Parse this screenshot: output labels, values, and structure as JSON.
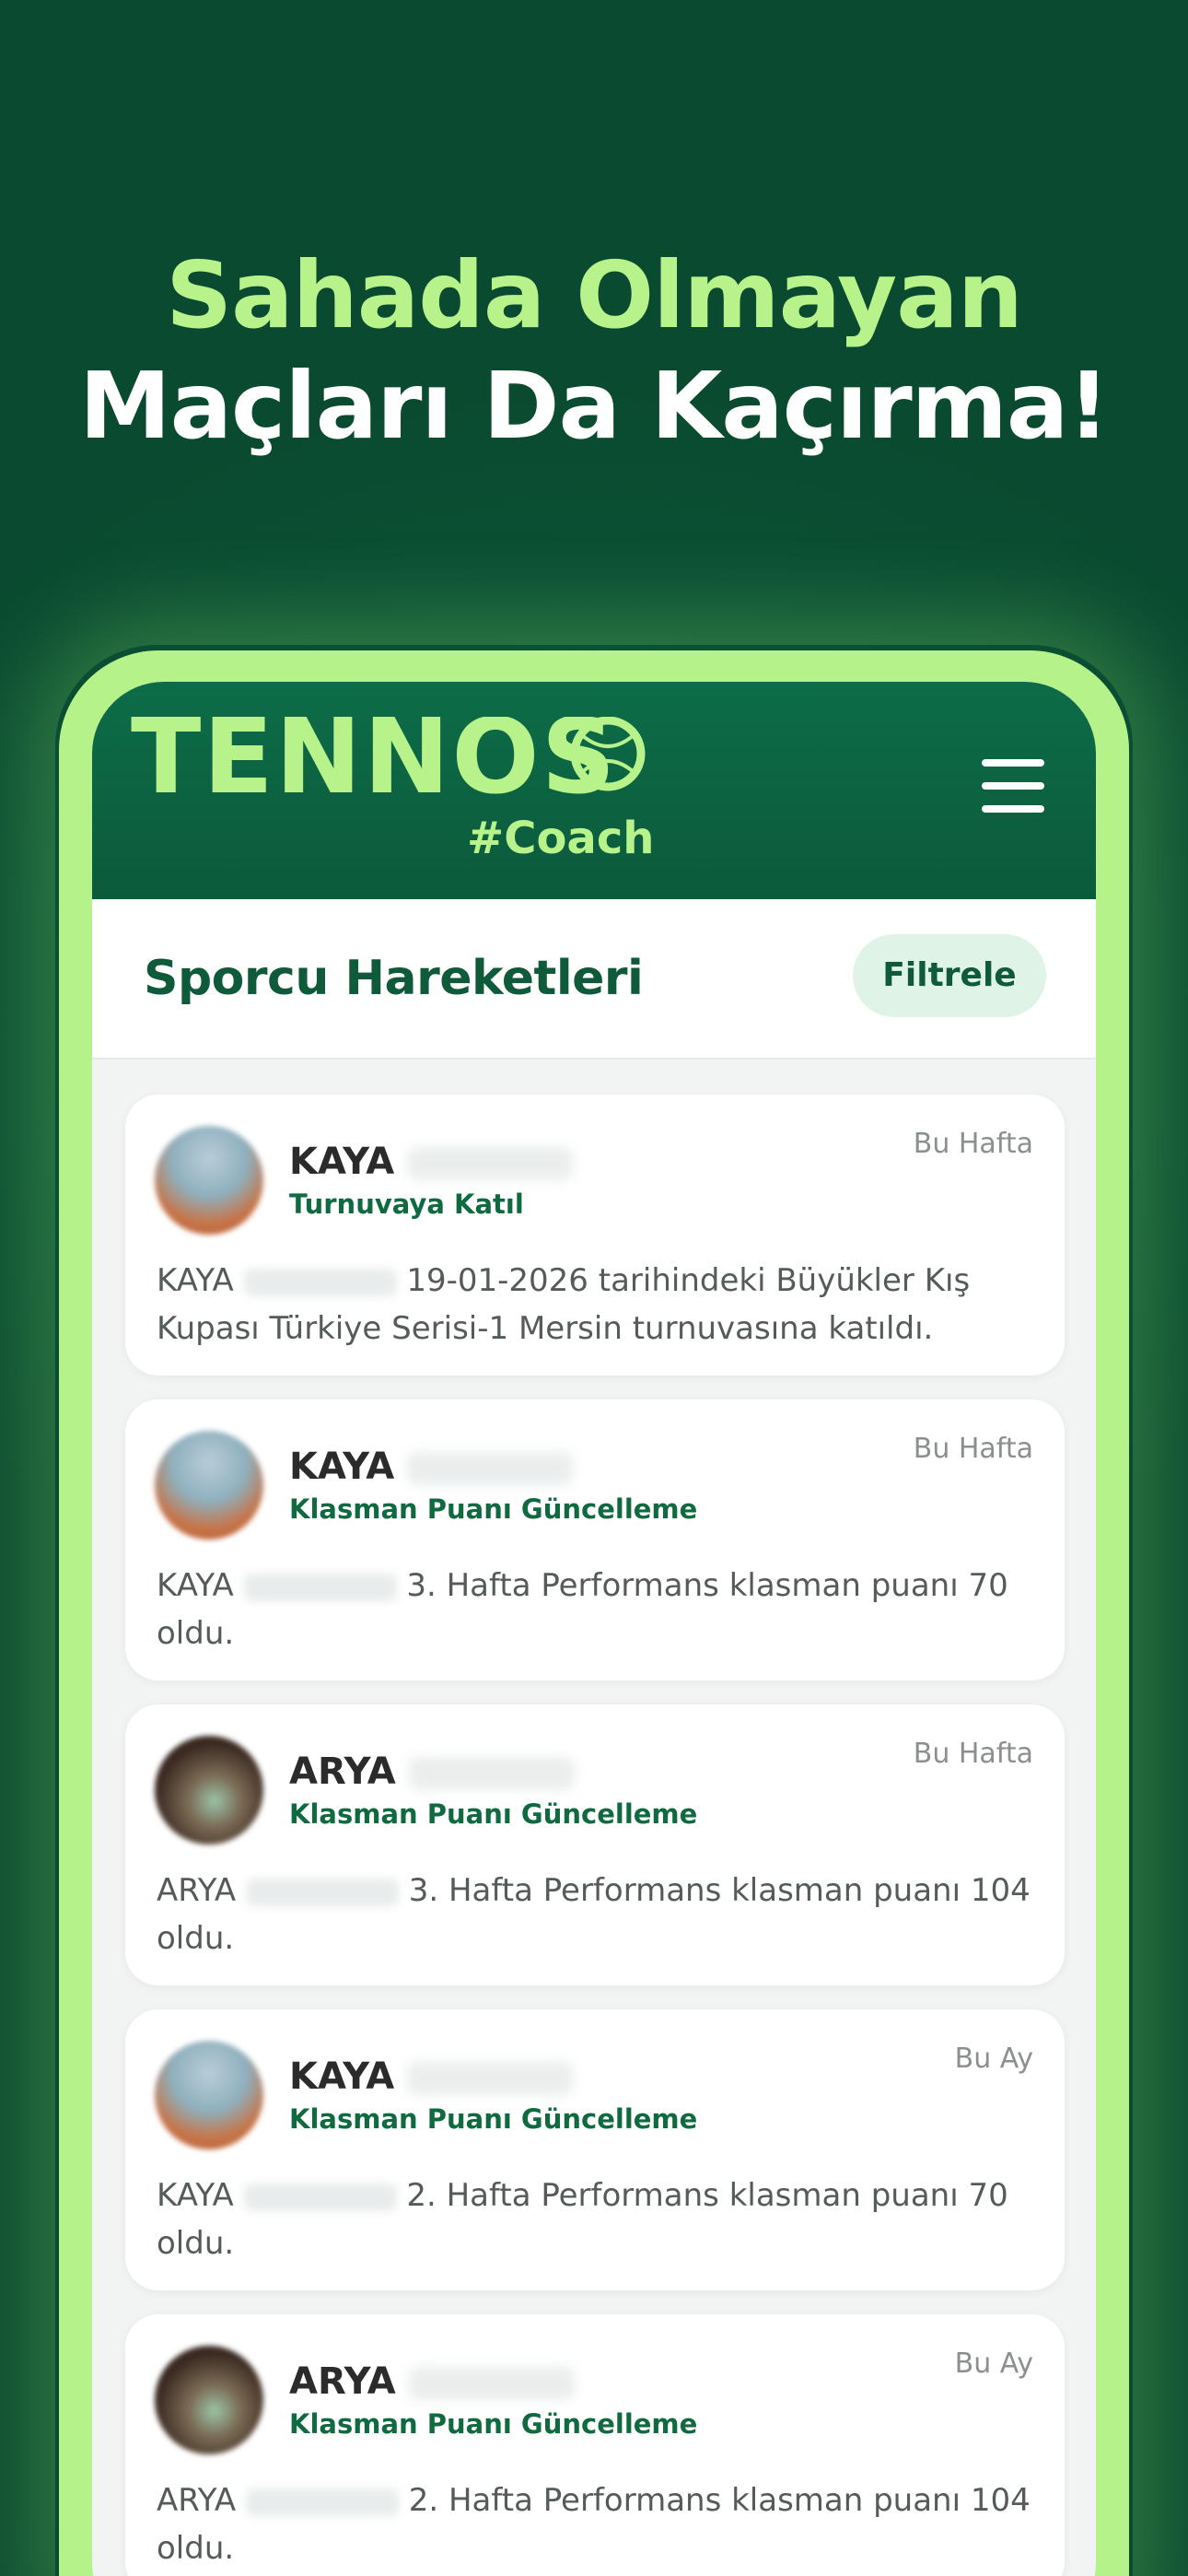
{
  "headline": {
    "line1": "Sahada Olmayan",
    "line2": "Maçları Da Kaçırma!"
  },
  "app": {
    "logo": {
      "word": "TENNOS",
      "tag": "#Coach"
    },
    "page_title": "Sporcu Hareketleri",
    "filter_label": "Filtrele"
  },
  "colors": {
    "brand_green": "#0b5a3b",
    "accent_lime": "#b7f28a",
    "action_green": "#0f6a40"
  },
  "feed": [
    {
      "name": "KAYA",
      "action": "Turnuvaya Katıl",
      "time": "Bu Hafta",
      "desc_name": "KAYA",
      "desc_text": "19-01-2026 tarihindeki Büyükler Kış Kupası Türkiye Serisi-1 Mersin turnuvasına katıldı.",
      "avatar": "player-photo"
    },
    {
      "name": "KAYA",
      "action": "Klasman Puanı Güncelleme",
      "time": "Bu Hafta",
      "desc_name": "KAYA",
      "desc_text": "3. Hafta Performans klasman puanı 70 oldu.",
      "avatar": "player-photo"
    },
    {
      "name": "ARYA",
      "action": "Klasman Puanı Güncelleme",
      "time": "Bu Hafta",
      "desc_name": "ARYA",
      "desc_text": "3. Hafta Performans klasman puanı 104 oldu.",
      "avatar": "player-photo"
    },
    {
      "name": "KAYA",
      "action": "Klasman Puanı Güncelleme",
      "time": "Bu Ay",
      "desc_name": "KAYA",
      "desc_text": "2. Hafta Performans klasman puanı 70 oldu.",
      "avatar": "player-photo"
    },
    {
      "name": "ARYA",
      "action": "Klasman Puanı Güncelleme",
      "time": "Bu Ay",
      "desc_name": "ARYA",
      "desc_text": "2. Hafta Performans klasman puanı 104 oldu.",
      "avatar": "player-photo"
    }
  ]
}
